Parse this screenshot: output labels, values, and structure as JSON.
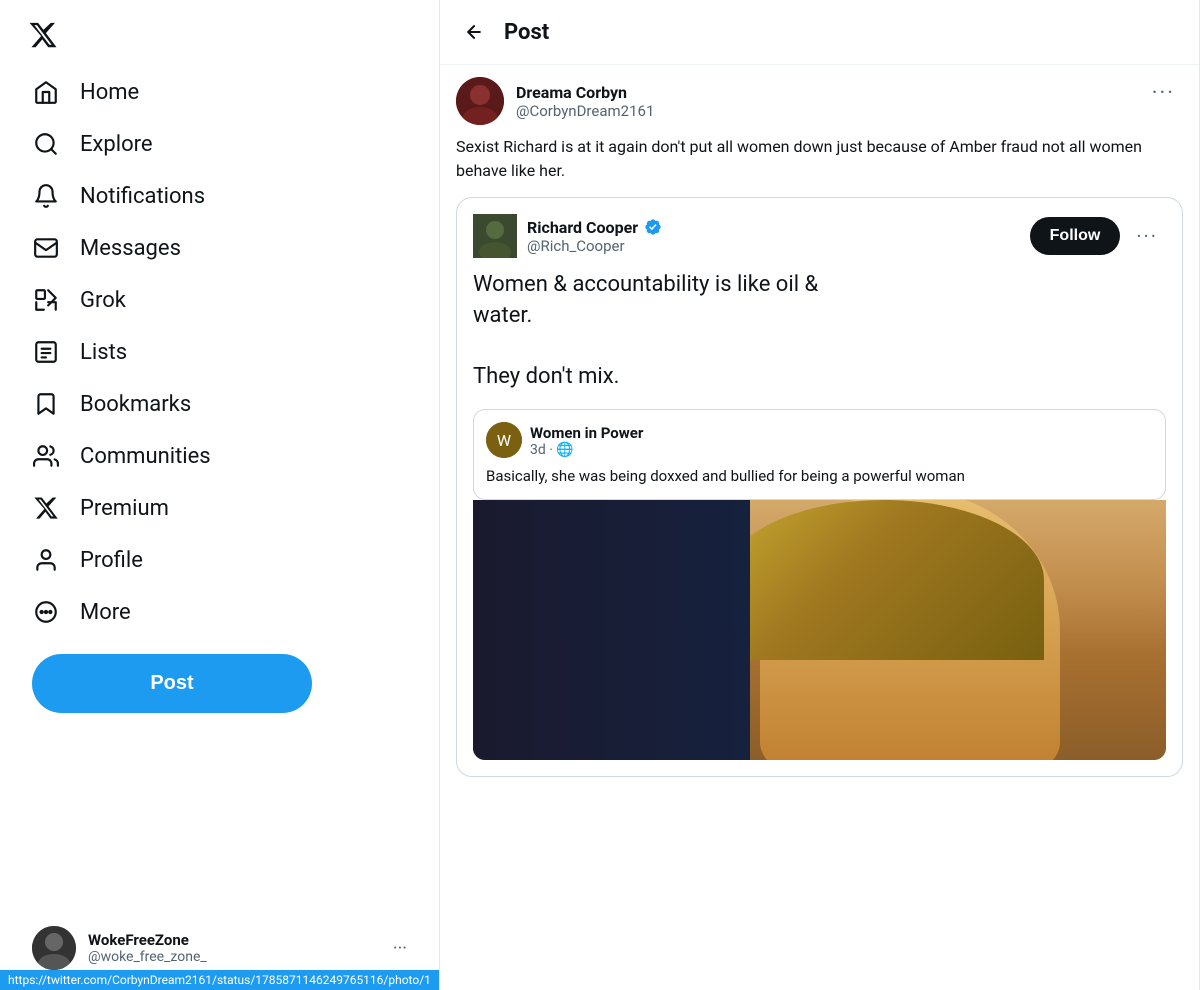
{
  "sidebar": {
    "logo_label": "X logo",
    "nav_items": [
      {
        "id": "home",
        "label": "Home",
        "icon": "home-icon"
      },
      {
        "id": "explore",
        "label": "Explore",
        "icon": "explore-icon"
      },
      {
        "id": "notifications",
        "label": "Notifications",
        "icon": "notifications-icon"
      },
      {
        "id": "messages",
        "label": "Messages",
        "icon": "messages-icon"
      },
      {
        "id": "grok",
        "label": "Grok",
        "icon": "grok-icon"
      },
      {
        "id": "lists",
        "label": "Lists",
        "icon": "lists-icon"
      },
      {
        "id": "bookmarks",
        "label": "Bookmarks",
        "icon": "bookmarks-icon"
      },
      {
        "id": "communities",
        "label": "Communities",
        "icon": "communities-icon"
      },
      {
        "id": "premium",
        "label": "Premium",
        "icon": "premium-icon"
      },
      {
        "id": "profile",
        "label": "Profile",
        "icon": "profile-icon"
      },
      {
        "id": "more",
        "label": "More",
        "icon": "more-icon"
      }
    ],
    "post_button_label": "Post",
    "footer": {
      "name": "WokeFreeZone",
      "handle": "@woke_free_zone_",
      "more_label": "···"
    }
  },
  "post_page": {
    "back_label": "←",
    "title": "Post",
    "tweet": {
      "author_name": "Dreama Corbyn",
      "author_handle": "@CorbynDream2161",
      "text": "Sexist Richard is at it again don't put all women down just because of Amber fraud not all women behave like her.",
      "more_btn": "···"
    },
    "quoted_tweet": {
      "author_name": "Richard Cooper",
      "author_handle": "@Rich_Cooper",
      "verified": true,
      "follow_label": "Follow",
      "more_btn": "···",
      "text_line1": "Women & accountability is like oil &",
      "text_line2": "water.",
      "text_line3": "",
      "text_line4": "They don't mix.",
      "nested_quote": {
        "author_name": "Women in Power",
        "meta": "3d · 🌐",
        "text": "Basically, she was being doxxed and bullied for being a powerful woman"
      }
    }
  },
  "url_bar": {
    "url": "https://twitter.com/CorbynDream2161/status/1785871146249765116/photo/1"
  }
}
